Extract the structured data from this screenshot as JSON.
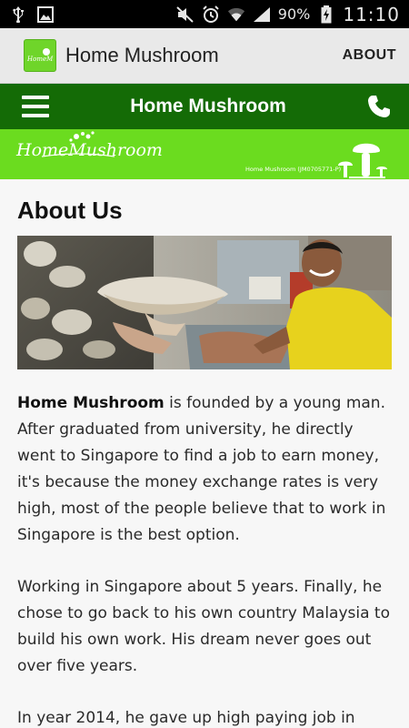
{
  "status_bar": {
    "battery": "90%",
    "time": "11:10"
  },
  "app_bar": {
    "title": "Home Mushroom",
    "action": "ABOUT",
    "icon_text": "HomeMushroom"
  },
  "nav": {
    "title": "Home Mushroom",
    "menu_icon": "hamburger-menu-icon",
    "call_icon": "phone-icon"
  },
  "banner": {
    "logo": "HomeMushroom",
    "registration": "Home Mushroom (JM0705771-P)"
  },
  "page": {
    "heading": "About Us",
    "paragraph1_bold": "Home Mushroom",
    "paragraph1_rest": " is founded by a young man. After graduated from university, he directly went to Singapore to find a job to earn money, it's because the money exchange rates is very high, most of the people believe that to work in Singapore is the best option.",
    "paragraph2": "Working in Singapore about 5 years. Finally, he chose to go back to his own country Malaysia to build his own work. His dream never goes out over five years.",
    "paragraph3": "In year 2014, he gave up high paying job in"
  },
  "colors": {
    "nav_green": "#146b06",
    "banner_green": "#6bdc1f",
    "app_bar_bg": "#e9e9e9"
  }
}
